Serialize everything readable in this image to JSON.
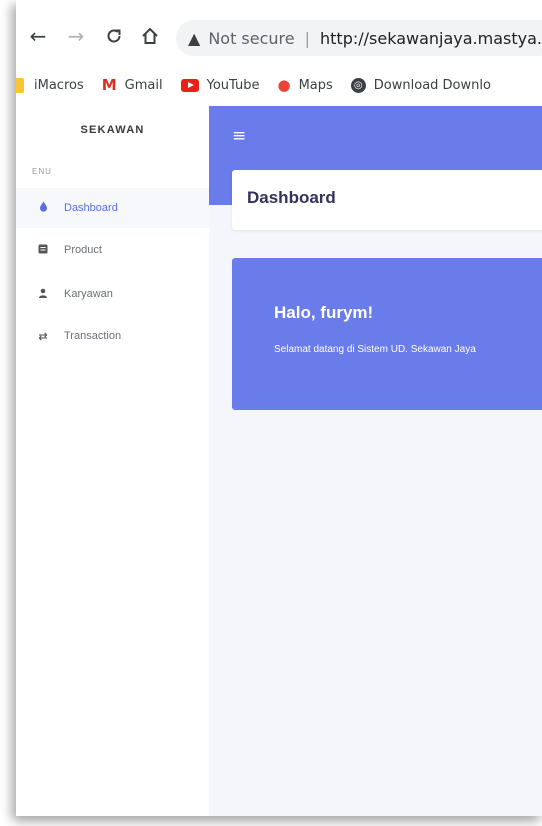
{
  "browser": {
    "security_label": "Not secure",
    "url": "http://sekawanjaya.mastya.my.",
    "bookmarks": [
      {
        "label": "iMacros"
      },
      {
        "label": "Gmail"
      },
      {
        "label": "YouTube"
      },
      {
        "label": "Maps"
      },
      {
        "label": "Download Downlo"
      }
    ]
  },
  "sidebar": {
    "brand": "SEKAWAN",
    "menu_label": "ENU",
    "items": [
      {
        "label": "Dashboard",
        "icon": "droplet-icon",
        "active": true
      },
      {
        "label": "Product",
        "icon": "box-icon",
        "active": false
      },
      {
        "label": "Karyawan",
        "icon": "user-icon",
        "active": false
      },
      {
        "label": "Transaction",
        "icon": "exchange-icon",
        "active": false
      }
    ]
  },
  "header": {
    "page_title": "Dashboard"
  },
  "welcome": {
    "title": "Halo, furym!",
    "message": "Selamat datang di Sistem UD. Sekawan Jaya"
  },
  "colors": {
    "accent": "#6a7bea",
    "sidebar_active_text": "#5b6ee1",
    "background": "#f4f6fb"
  }
}
